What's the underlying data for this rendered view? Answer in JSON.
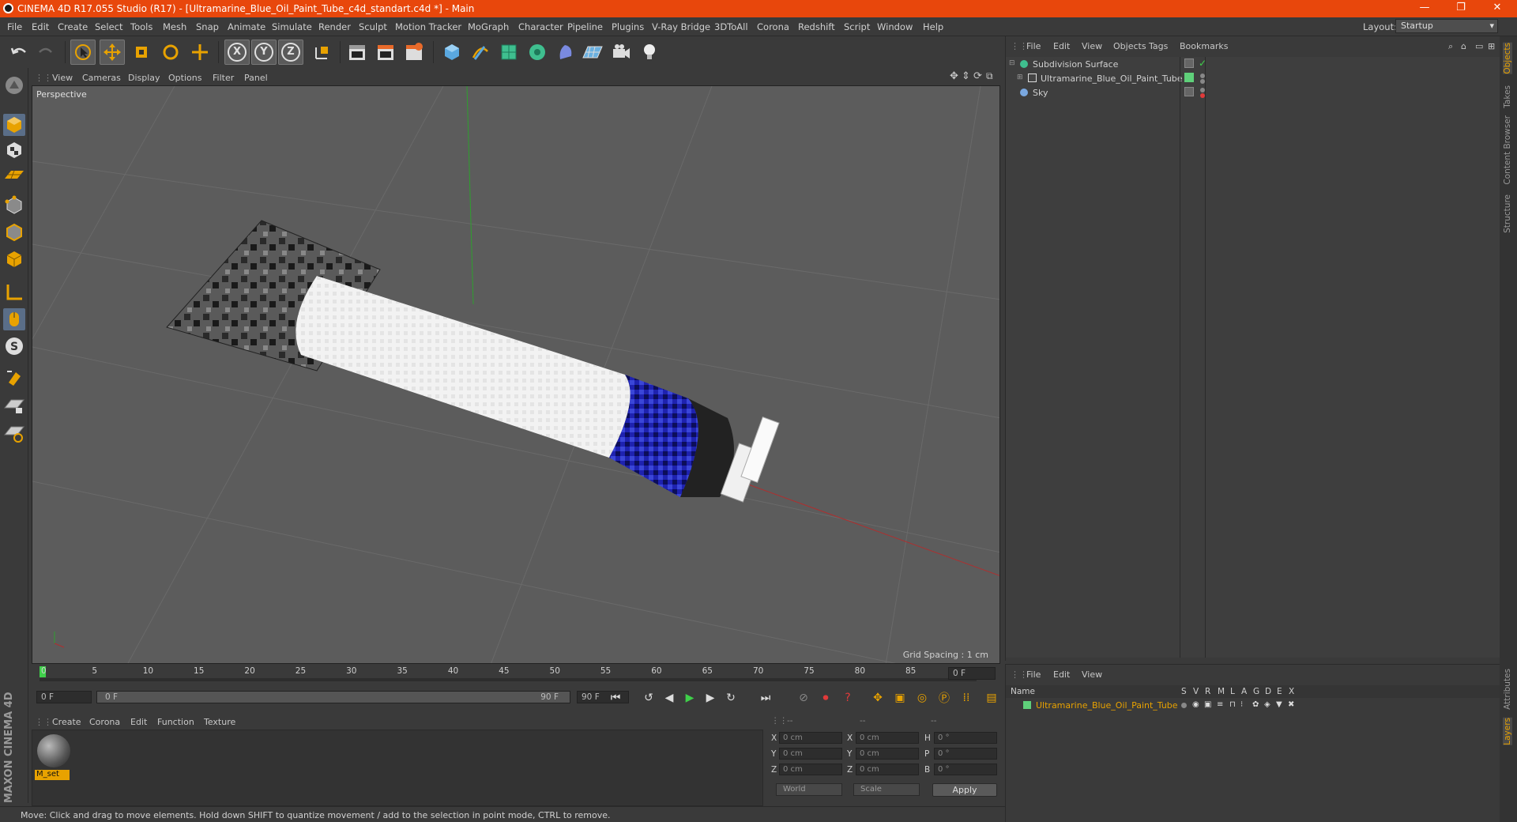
{
  "window": {
    "title": "CINEMA 4D R17.055 Studio (R17) - [Ultramarine_Blue_Oil_Paint_Tube_c4d_standart.c4d *] - Main",
    "controls": [
      "—",
      "❐",
      "✕"
    ]
  },
  "menubar": {
    "items": [
      "File",
      "Edit",
      "Create",
      "Select",
      "Tools",
      "Mesh",
      "Snap",
      "Animate",
      "Simulate",
      "Render",
      "Sculpt",
      "Motion Tracker",
      "MoGraph",
      "Character",
      "Pipeline",
      "Plugins",
      "V-Ray Bridge",
      "3DToAll",
      "Corona",
      "Redshift",
      "Script",
      "Window",
      "Help"
    ],
    "layout_label": "Layout:",
    "layout_value": "Startup"
  },
  "toolbar": {
    "axis_x": "X",
    "axis_y": "Y",
    "axis_z": "Z"
  },
  "viewport": {
    "menu": [
      "View",
      "Cameras",
      "Display",
      "Options",
      "Filter",
      "Panel"
    ],
    "label": "Perspective",
    "grid_spacing": "Grid Spacing : 1 cm"
  },
  "timeline": {
    "ticks": [
      "0",
      "5",
      "10",
      "15",
      "20",
      "25",
      "30",
      "35",
      "40",
      "45",
      "50",
      "55",
      "60",
      "65",
      "70",
      "75",
      "80",
      "85",
      "90"
    ],
    "current_frame": "0 F",
    "start_frame": "0 F",
    "range_start": "0 F",
    "range_end": "90 F",
    "end_frame": "90 F"
  },
  "materials": {
    "menu": [
      "Create",
      "Corona",
      "Edit",
      "Function",
      "Texture"
    ],
    "items": [
      {
        "name": "M_set"
      }
    ]
  },
  "coordinates": {
    "headers": [
      "--",
      "--",
      "--"
    ],
    "rows": [
      {
        "axis": "X",
        "pos": "0 cm",
        "axis2": "X",
        "size": "0 cm",
        "rot_label": "H",
        "rot": "0 °"
      },
      {
        "axis": "Y",
        "pos": "0 cm",
        "axis2": "Y",
        "size": "0 cm",
        "rot_label": "P",
        "rot": "0 °"
      },
      {
        "axis": "Z",
        "pos": "0 cm",
        "axis2": "Z",
        "size": "0 cm",
        "rot_label": "B",
        "rot": "0 °"
      }
    ],
    "mode_world": "World",
    "mode_scale": "Scale",
    "apply": "Apply"
  },
  "status": {
    "text": "Move: Click and drag to move elements. Hold down SHIFT to quantize movement / add to the selection in point mode, CTRL to remove."
  },
  "object_manager": {
    "menu": [
      "File",
      "Edit",
      "View",
      "Objects",
      "Tags",
      "Bookmarks"
    ],
    "objects": [
      {
        "name": "Subdivision Surface",
        "level": 0
      },
      {
        "name": "Ultramarine_Blue_Oil_Paint_Tube",
        "level": 1
      },
      {
        "name": "Sky",
        "level": 0
      }
    ]
  },
  "layer_manager": {
    "menu": [
      "File",
      "Edit",
      "View"
    ],
    "columns": [
      "Name",
      "S",
      "V",
      "R",
      "M",
      "L",
      "A",
      "G",
      "D",
      "E",
      "X"
    ],
    "layers": [
      {
        "name": "Ultramarine_Blue_Oil_Paint_Tube",
        "color": "#5fd07a"
      }
    ]
  },
  "right_tabs": [
    "Objects",
    "Takes",
    "Content Browser",
    "Structure"
  ],
  "right_tabs_bottom": [
    "Attributes",
    "Layers"
  ],
  "brand": "MAXON CINEMA 4D",
  "colors": {
    "title_bar": "#e8470c",
    "accent": "#e8a200",
    "tube_blue": "#1c1ca8",
    "selection": "#5a6e88"
  }
}
